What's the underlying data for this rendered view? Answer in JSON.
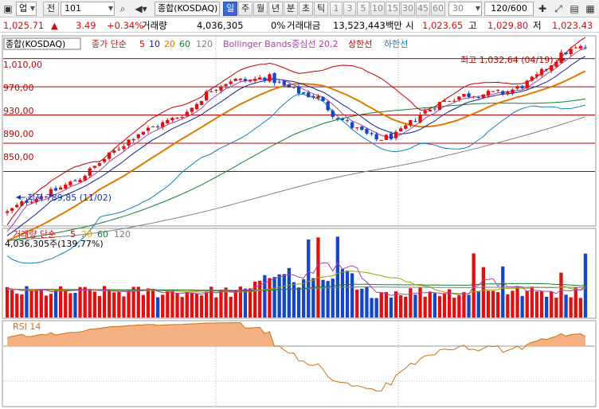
{
  "toolbar": {
    "period_button": "업",
    "all_button": "전",
    "code_value": "101",
    "name_value": "종합(KOSDAQ)",
    "tabs": [
      "일",
      "주",
      "월",
      "년",
      "분",
      "초",
      "틱"
    ],
    "active_tab": "일",
    "intervals": [
      "1",
      "3",
      "5",
      "10",
      "15",
      "30",
      "45",
      "60"
    ],
    "interval_value": "30",
    "count_value": "120/600"
  },
  "price_row": {
    "price": "1,025.71",
    "change_arrow": "▲",
    "change": "3.49",
    "change_pct": "+0.34%",
    "volume_label": "거래량",
    "volume": "4,036,305",
    "volume_pct": "0%",
    "amount_label": "거래대금",
    "amount": "13,523,443백만",
    "open_label": "시",
    "open": "1,023.65",
    "high_label": "고",
    "high": "1,029.80",
    "low_label": "저",
    "low": "1,023.43"
  },
  "price_panel": {
    "legend": {
      "name": "종합(KOSDAQ)",
      "ma_label": "종가 단순",
      "ma_periods": [
        "5",
        "10",
        "20",
        "60",
        "120"
      ],
      "bb_label": "Bollinger Bands중심선 20,2",
      "bb_upper": "상한선",
      "bb_lower": "하한선"
    },
    "y_labels": [
      "1,010,00",
      "970,00",
      "930,00",
      "890,00",
      "850,00"
    ],
    "high_note": "최고 1,032,64 (04/19)",
    "low_note": "최저 789,85 (11/02)"
  },
  "volume_panel": {
    "legend": {
      "label": "거래량 단순",
      "ma_periods": [
        "5",
        "20",
        "60",
        "120"
      ]
    },
    "value_text": "4,036,305주(139,77%)"
  },
  "rsi_panel": {
    "label": "RSI 14"
  },
  "colors": {
    "up": "#e01010",
    "down": "#1446c8",
    "ma5": "#c00000",
    "ma10": "#1020a0",
    "ma20": "#e07800",
    "ma60": "#108030",
    "ma120": "#808080",
    "bb_mid": "#aa40aa",
    "bb_upper": "#c00000",
    "bb_lower": "#1080c0",
    "rsi": "#d07010",
    "rsi_fill": "#f4b080",
    "grid_red": "#c00000",
    "volume_avg": "#a0a000"
  },
  "chart_data": {
    "type": "candlestick",
    "count": 120,
    "price_ylim": [
      775,
      1040
    ],
    "horizontal_levels": [
      1010,
      970,
      930,
      890,
      850
    ],
    "high": {
      "value": 1032.64,
      "date": "04/19"
    },
    "low": {
      "value": 789.85,
      "date": "11/02"
    },
    "close_keypoints": [
      [
        0,
        792
      ],
      [
        5,
        808
      ],
      [
        12,
        820
      ],
      [
        20,
        840
      ],
      [
        28,
        872
      ],
      [
        36,
        904
      ],
      [
        44,
        920
      ],
      [
        50,
        935
      ],
      [
        56,
        965
      ],
      [
        62,
        980
      ],
      [
        67,
        978
      ],
      [
        72,
        985
      ],
      [
        76,
        972
      ],
      [
        82,
        960
      ],
      [
        86,
        955
      ],
      [
        90,
        932
      ],
      [
        96,
        912
      ],
      [
        102,
        895
      ],
      [
        108,
        902
      ],
      [
        114,
        930
      ],
      [
        120,
        948
      ],
      [
        126,
        958
      ],
      [
        132,
        960
      ],
      [
        138,
        962
      ],
      [
        142,
        970
      ],
      [
        146,
        982
      ],
      [
        150,
        1000
      ],
      [
        154,
        1018
      ],
      [
        158,
        1025
      ],
      [
        160,
        1026
      ]
    ],
    "volume_last": 4036305,
    "volume_last_pct": 139.77,
    "rsi_range": [
      0,
      100
    ],
    "rsi_levels": [
      70,
      30
    ]
  }
}
